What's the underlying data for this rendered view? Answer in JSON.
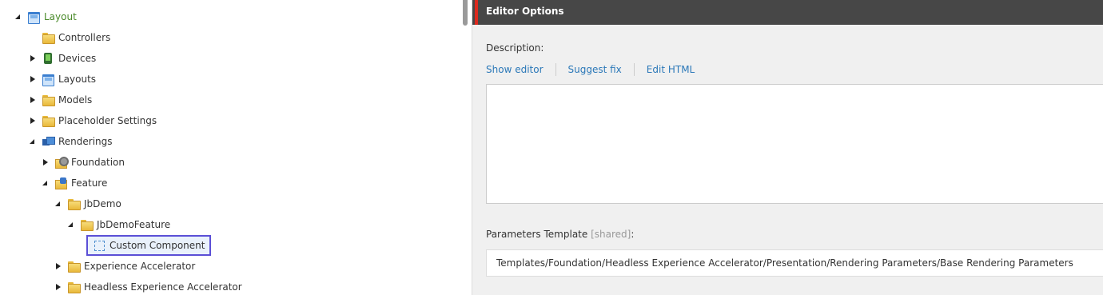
{
  "tree": {
    "items": [
      {
        "label": "",
        "icon": "page-icon"
      },
      {
        "label": "Layout",
        "icon": "layout-icon"
      },
      {
        "label": "Controllers",
        "icon": "folder-icon"
      },
      {
        "label": "Devices",
        "icon": "device-icon"
      },
      {
        "label": "Layouts",
        "icon": "layout-icon"
      },
      {
        "label": "Models",
        "icon": "folder-icon"
      },
      {
        "label": "Placeholder Settings",
        "icon": "folder-icon"
      },
      {
        "label": "Renderings",
        "icon": "renderings-icon"
      },
      {
        "label": "Foundation",
        "icon": "foundation-folder-icon"
      },
      {
        "label": "Feature",
        "icon": "feature-folder-icon"
      },
      {
        "label": "JbDemo",
        "icon": "folder-icon"
      },
      {
        "label": "JbDemoFeature",
        "icon": "folder-icon"
      },
      {
        "label": "Custom Component",
        "icon": "component-icon"
      },
      {
        "label": "Experience Accelerator",
        "icon": "folder-icon"
      },
      {
        "label": "Headless Experience Accelerator",
        "icon": "folder-icon"
      }
    ]
  },
  "editor": {
    "header_title": "Editor Options",
    "accent_color": "#dc291e",
    "description_label": "Description:",
    "links": {
      "show_editor": "Show editor",
      "suggest_fix": "Suggest fix",
      "edit_html": "Edit HTML"
    },
    "description_value": "",
    "params_label": "Parameters Template",
    "params_shared": "[shared]",
    "params_colon": ":",
    "params_value": "Templates/Foundation/Headless Experience Accelerator/Presentation/Rendering Parameters/Base Rendering Parameters"
  }
}
